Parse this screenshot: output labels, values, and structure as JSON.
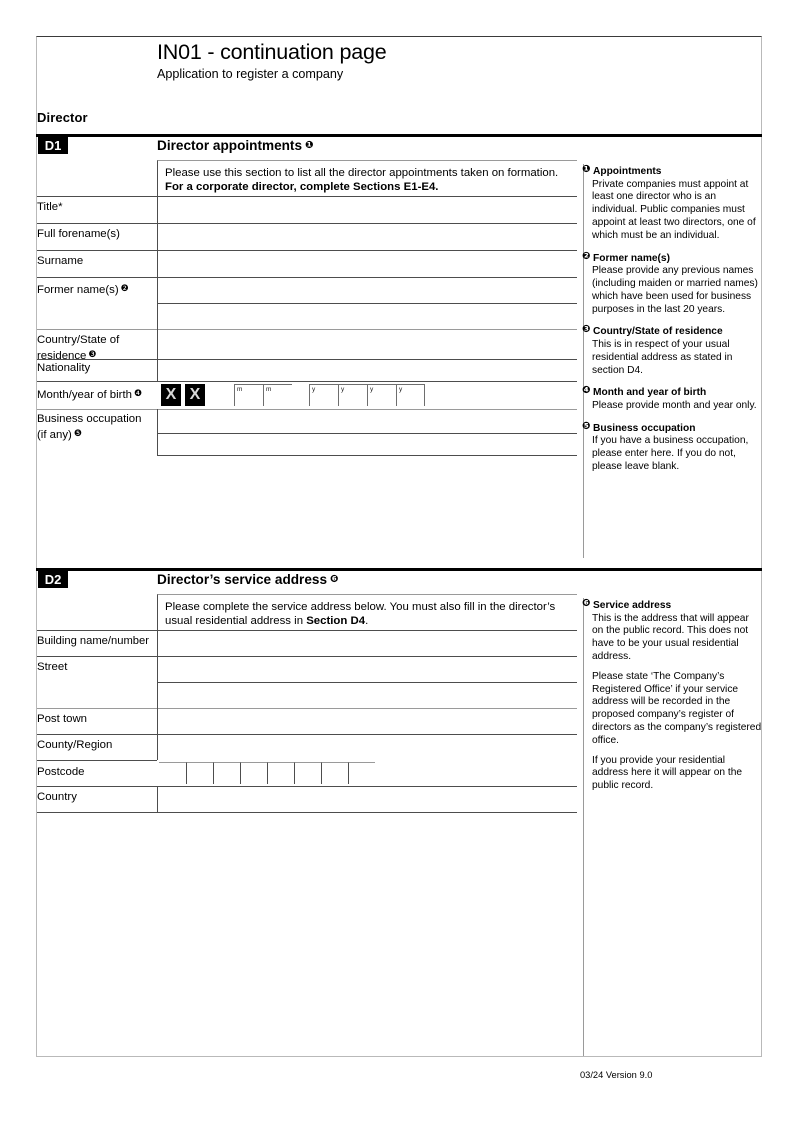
{
  "header": {
    "title": "IN01 - continuation page",
    "subtitle": "Application to register a company"
  },
  "group_title": "Director",
  "sections": [
    {
      "tag": "D1",
      "heading": "Director appointments",
      "heading_note": "❶",
      "instruction_line1": "Please use this section to list all the director appointments taken on formation.",
      "instruction_line2": "For a corporate director, complete Sections E1-E4.",
      "fields": [
        {
          "label": "Title*",
          "note": "",
          "value": ""
        },
        {
          "label": "Full forename(s)",
          "note": "",
          "value": ""
        },
        {
          "label": "Surname",
          "note": "",
          "value": ""
        },
        {
          "label": "Former name(s)",
          "note": "❷",
          "value": ""
        },
        {
          "label": "Country/State of residence",
          "note": "❸",
          "value": ""
        },
        {
          "label": "Nationality",
          "note": "",
          "value": ""
        },
        {
          "label": "Month/year of birth",
          "note": "❹",
          "value": ""
        },
        {
          "label": "Business occupation (if any)",
          "note": "❺",
          "value": ""
        }
      ],
      "dob": {
        "masked": [
          "X",
          "X"
        ],
        "month_hints": [
          "m",
          "m"
        ],
        "year_hints": [
          "y",
          "y",
          "y",
          "y"
        ]
      },
      "notes": [
        {
          "marker": "❶",
          "title": "Appointments",
          "body": [
            "Private companies must appoint at least one director who is an individual. Public companies must appoint at least two directors, one of which must be an individual."
          ]
        },
        {
          "marker": "❷",
          "title": "Former name(s)",
          "body": [
            "Please provide any previous names (including maiden or married names) which have been used for business purposes in the last 20 years."
          ]
        },
        {
          "marker": "❸",
          "title": "Country/State of residence",
          "body": [
            "This is in respect of your usual residential address as stated in section D4."
          ]
        },
        {
          "marker": "❹",
          "title": "Month and year of birth",
          "body": [
            "Please provide month and year only."
          ]
        },
        {
          "marker": "❺",
          "title": "Business occupation",
          "body": [
            "If you have a business occupation, please enter here. If you do not, please leave blank."
          ]
        }
      ]
    },
    {
      "tag": "D2",
      "heading": "Director’s service address",
      "heading_note": "❻",
      "instruction_line1": "Please complete the service address below. You must also fill in the director’s",
      "instruction_line2a": "usual residential address in ",
      "instruction_line2b": "Section D4",
      "instruction_line2c": ".",
      "fields": [
        {
          "label": "Building name/number",
          "value": ""
        },
        {
          "label": "Street",
          "value": ""
        },
        {
          "label": "Post town",
          "value": ""
        },
        {
          "label": "County/Region",
          "value": ""
        },
        {
          "label": "Postcode",
          "value": ""
        },
        {
          "label": "Country",
          "value": ""
        }
      ],
      "postcode_cells": 8,
      "notes": [
        {
          "marker": "❻",
          "title": "Service address",
          "body": [
            "This is the address that will appear on the public record. This does not have to be your usual residential address.",
            "Please state ‘The Company’s Registered Office’ if your service address will be recorded in the proposed company’s register of directors as the company’s registered office.",
            "If you provide your residential address here it will appear on the public record."
          ]
        }
      ]
    }
  ],
  "footer": "03/24 Version 9.0"
}
